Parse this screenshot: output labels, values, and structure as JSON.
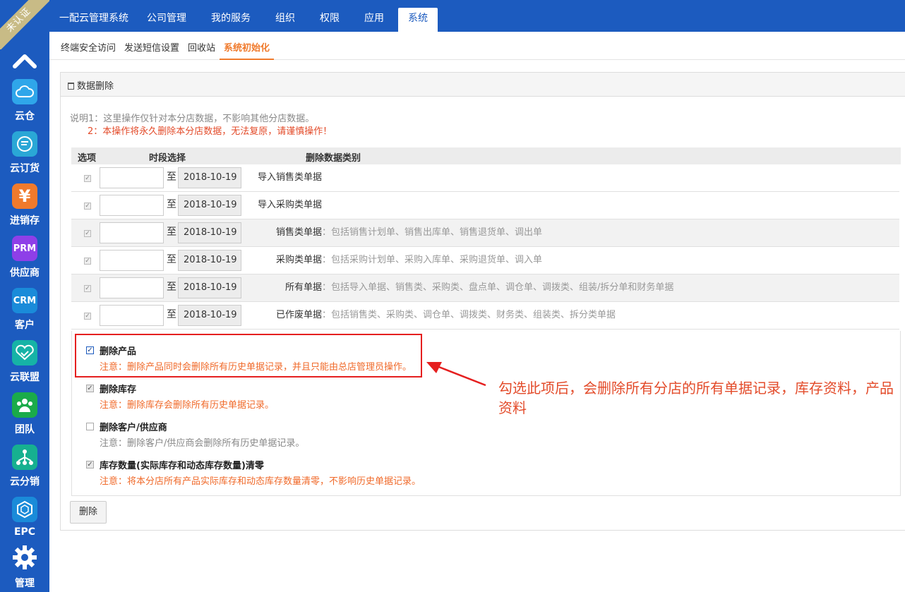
{
  "ribbon": "未认证",
  "sidebar": {
    "items": [
      {
        "label": "云仓",
        "icon": "cloud-icon",
        "color": "#2fa6ea"
      },
      {
        "label": "云订货",
        "icon": "chat-icon",
        "color": "#2aa7d6"
      },
      {
        "label": "进销存",
        "icon": "yen-icon",
        "color": "#f07a2c",
        "glyph": "¥"
      },
      {
        "label": "供应商",
        "icon": "prm-icon",
        "color": "#8e3fe8",
        "glyph": "PRM"
      },
      {
        "label": "客户",
        "icon": "crm-icon",
        "color": "#1a8bd9",
        "glyph": "CRM"
      },
      {
        "label": "云联盟",
        "icon": "handshake-icon",
        "color": "#16b3a6"
      },
      {
        "label": "团队",
        "icon": "team-icon",
        "color": "#1aab4a"
      },
      {
        "label": "云分销",
        "icon": "network-icon",
        "color": "#16b090"
      },
      {
        "label": "EPC",
        "icon": "cube-icon",
        "color": "#1a8bd9"
      },
      {
        "label": "管理",
        "icon": "gear-icon",
        "color": "#1c5bbf"
      }
    ]
  },
  "topnav": {
    "items": [
      "一配云管理系统",
      "公司管理",
      "我的服务",
      "组织",
      "权限",
      "应用",
      "系统"
    ],
    "active": "系统"
  },
  "subtabs": {
    "items": [
      "终端安全访问",
      "发送短信设置",
      "回收站",
      "系统初始化"
    ],
    "active": "系统初始化"
  },
  "panel": {
    "title": "数据删除",
    "note1": "说明1：这里操作仅针对本分店数据，不影响其他分店数据。",
    "note2": "2：本操作将永久删除本分店数据，无法复原，请谨慎操作！",
    "headers": {
      "option": "选项",
      "period": "时段选择",
      "category": "删除数据类别"
    },
    "to_label": "至",
    "rows": [
      {
        "date": "2018-10-19",
        "label": "导入销售类单据",
        "desc": ""
      },
      {
        "date": "2018-10-19",
        "label": "导入采购类单据",
        "desc": ""
      },
      {
        "date": "2018-10-19",
        "label": "销售类单据",
        "desc": "：包括销售计划单、销售出库单、销售退货单、调出单"
      },
      {
        "date": "2018-10-19",
        "label": "采购类单据",
        "desc": "：包括采购计划单、采购入库单、采购退货单、调入单"
      },
      {
        "date": "2018-10-19",
        "label": "所有单据",
        "desc": "：包括导入单据、销售类、采购类、盘点单、调仓单、调拨类、组装/拆分单和财务单据"
      },
      {
        "date": "2018-10-19",
        "label": "已作废单据",
        "desc": "：包括销售类、采购类、调仓单、调拨类、财务类、组装类、拆分类单据"
      }
    ],
    "options": [
      {
        "title": "删除产品",
        "note": "注意：删除产品同时会删除所有历史单据记录，并且只能由总店管理员操作。",
        "checked": true
      },
      {
        "title": "删除库存",
        "note": "注意：删除库存会删除所有历史单据记录。",
        "checked": true
      },
      {
        "title": "删除客户/供应商",
        "note": "注意：删除客户/供应商会删除所有历史单据记录。",
        "checked": false
      },
      {
        "title": "库存数量(实际库存和动态库存数量)清零",
        "note": "注意：将本分店所有产品实际库存和动态库存数量清零，不影响历史单据记录。",
        "checked": true
      }
    ],
    "delete_button": "删除"
  },
  "annotation": "勾选此项后，会删除所有分店的所有单据记录，库存资料，产品资料"
}
